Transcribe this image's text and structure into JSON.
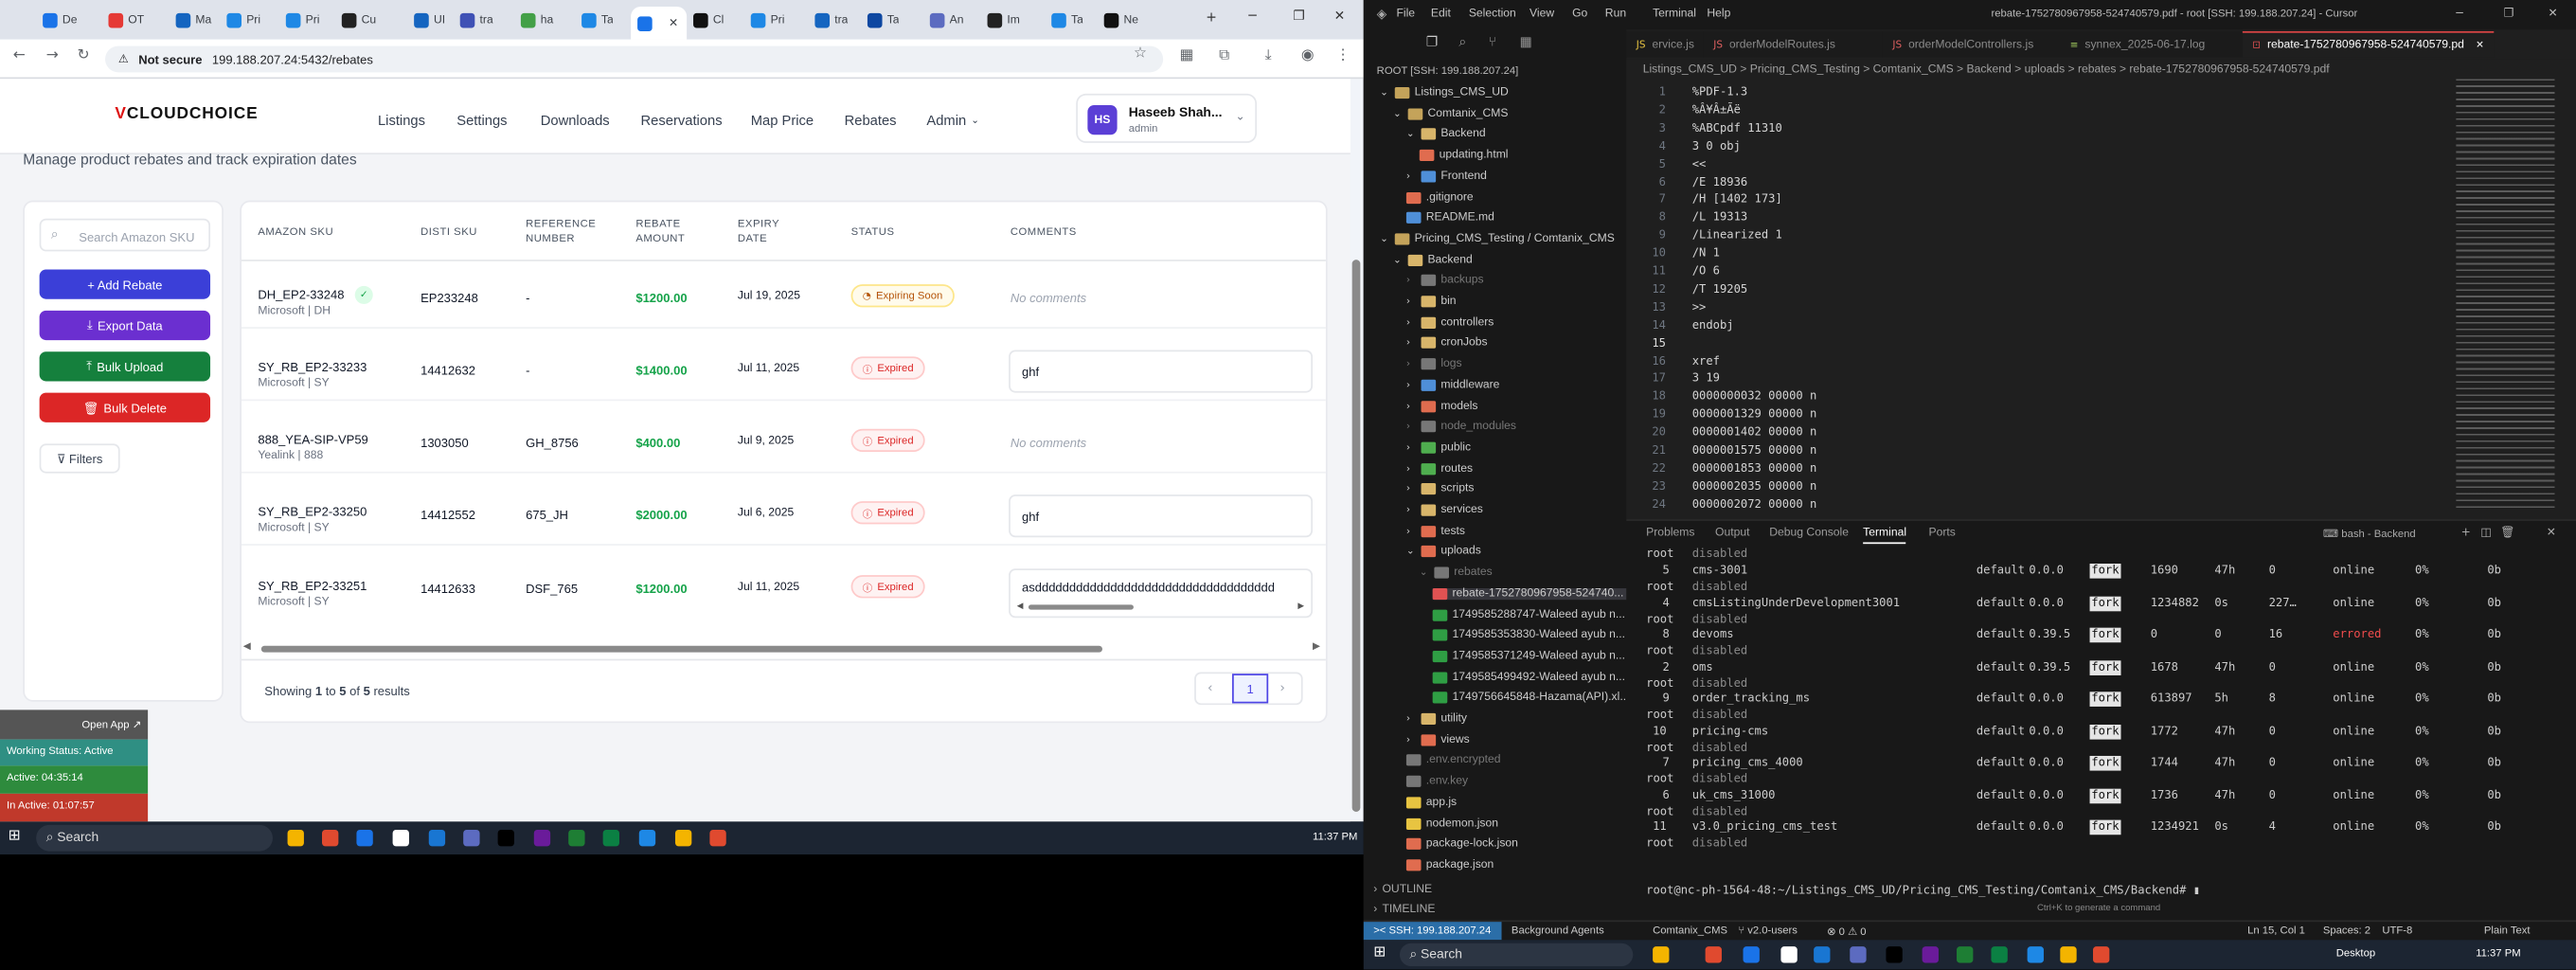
{
  "browser": {
    "tabs": [
      "De",
      "OT",
      "Ma",
      "Pri",
      "Pri",
      "Cu",
      "UI",
      "tra",
      "ha",
      "Ta",
      "",
      "Cl",
      "Pri",
      "tra",
      "Ta",
      "An",
      "Im",
      "Ta",
      "Ne"
    ],
    "security": "Not secure",
    "url": "199.188.207.24:5432/rebates"
  },
  "app": {
    "brand": "CLOUDCHOICE",
    "brand_v": "V",
    "nav": [
      "Listings",
      "Settings",
      "Downloads",
      "Reservations",
      "Map Price",
      "Rebates",
      "Admin"
    ],
    "user": {
      "initials": "HS",
      "name": "Haseeb Shah...",
      "role": "admin"
    },
    "subtitle": "Manage product rebates and track expiration dates",
    "search_placeholder": "Search Amazon SKU",
    "buttons": {
      "add": "+ Add Rebate",
      "export": "Export Data",
      "upload": "Bulk Upload",
      "delete": "Bulk Delete",
      "filters": "Filters"
    },
    "columns": [
      "AMAZON SKU",
      "DISTI SKU",
      "REFERENCE NUMBER",
      "REBATE AMOUNT",
      "EXPIRY DATE",
      "STATUS",
      "COMMENTS"
    ],
    "rows": [
      {
        "sku": "DH_EP2-33248",
        "vendor": "Microsoft | DH",
        "disti": "EP233248",
        "ref": "-",
        "amount": "$1200.00",
        "expiry": "Jul 19, 2025",
        "status": "Expiring Soon",
        "comment": "No comments"
      },
      {
        "sku": "SY_RB_EP2-33233",
        "vendor": "Microsoft | SY",
        "disti": "14412632",
        "ref": "-",
        "amount": "$1400.00",
        "expiry": "Jul 11, 2025",
        "status": "Expired",
        "comment": "ghf"
      },
      {
        "sku": "888_YEA-SIP-VP59",
        "vendor": "Yealink | 888",
        "disti": "1303050",
        "ref": "GH_8756",
        "amount": "$400.00",
        "expiry": "Jul 9, 2025",
        "status": "Expired",
        "comment": "No comments"
      },
      {
        "sku": "SY_RB_EP2-33250",
        "vendor": "Microsoft | SY",
        "disti": "14412552",
        "ref": "675_JH",
        "amount": "$2000.00",
        "expiry": "Jul 6, 2025",
        "status": "Expired",
        "comment": "ghf"
      },
      {
        "sku": "SY_RB_EP2-33251",
        "vendor": "Microsoft | SY",
        "disti": "14412633",
        "ref": "DSF_765",
        "amount": "$1200.00",
        "expiry": "Jul 11, 2025",
        "status": "Expired",
        "comment": "asddddddddddddddddddddddddddddddddddd"
      }
    ],
    "showing": {
      "pre": "Showing",
      "from": "1",
      "to_word": "to",
      "to": "5",
      "of_word": "of",
      "total": "5",
      "post": "results"
    },
    "page": "1"
  },
  "widget": {
    "open": "Open App",
    "working": "Working Status: Active",
    "active": "Active: 04:35:14",
    "inactive": "In Active: 01:07:57"
  },
  "taskbar": {
    "search": "Search",
    "time": "11:37 PM",
    "desktop": "Desktop"
  },
  "vscode": {
    "title": "rebate-1752780967958-524740579.pdf - root [SSH: 199.188.207.24] - Cursor",
    "menus": [
      "File",
      "Edit",
      "Selection",
      "View",
      "Go",
      "Run",
      "Terminal",
      "Help"
    ],
    "tabs": [
      "ervice.js",
      "orderModelRoutes.js",
      "orderModelControllers.js",
      "synnex_2025-06-17.log",
      "rebate-1752780967958-524740579.pdf"
    ],
    "breadcrumb": "Listings_CMS_UD > Pricing_CMS_Testing > Comtanix_CMS > Backend > uploads > rebates > rebate-1752780967958-524740579.pdf",
    "root_label": "ROOT [SSH: 199.188.207.24]",
    "tree": [
      "Listings_CMS_UD",
      "Comtanix_CMS",
      "Backend",
      "updating.html",
      "Frontend",
      ".gitignore",
      "README.md",
      "Pricing_CMS_Testing / Comtanix_CMS",
      "Backend",
      "backups",
      "bin",
      "controllers",
      "cronJobs",
      "logs",
      "middleware",
      "models",
      "node_modules",
      "public",
      "routes",
      "scripts",
      "services",
      "tests",
      "uploads",
      "rebates",
      "rebate-1752780967958-524740...",
      "1749585288747-Waleed ayub n...",
      "1749585353830-Waleed ayub n...",
      "1749585371249-Waleed ayub n...",
      "1749585499492-Waleed ayub n...",
      "1749756645848-Hazama(API).xl...",
      "utility",
      "views",
      ".env.encrypted",
      ".env.key",
      "app.js",
      "nodemon.json",
      "package-lock.json",
      "package.json"
    ],
    "outline": "OUTLINE",
    "timeline": "TIMELINE",
    "code": [
      "%PDF-1.3",
      "%Â¥Â±Ãë",
      "%ABCpdf 11310",
      "3 0 obj",
      "<<",
      "/E 18936",
      "/H [1402 173]",
      "/L 19313",
      "/Linearized 1",
      "/N 1",
      "/O 6",
      "/T 19205",
      ">>",
      "endobj",
      "",
      "xref",
      "3 19",
      "0000000032 00000 n",
      "0000001329 00000 n",
      "0000001402 00000 n",
      "0000001575 00000 n",
      "0000001853 00000 n",
      "0000002035 00000 n",
      "0000002072 00000 n"
    ],
    "panel_tabs": [
      "Problems",
      "Output",
      "Debug Console",
      "Terminal",
      "Ports"
    ],
    "terminal_label": "bash - Backend",
    "procs": [
      {
        "id": "5",
        "name": "cms-3001",
        "ns": "default",
        "ver": "0.0.0",
        "mode": "fork",
        "pid": "1690",
        "up": "47h",
        "rst": "0",
        "status": "online",
        "cpu": "0%",
        "mem": "0b"
      },
      {
        "id": "4",
        "name": "cmsListingUnderDevelopment3001",
        "ns": "default",
        "ver": "0.0.0",
        "mode": "fork",
        "pid": "1234882",
        "up": "0s",
        "rst": "227…",
        "status": "online",
        "cpu": "0%",
        "mem": "0b"
      },
      {
        "id": "8",
        "name": "devoms",
        "ns": "default",
        "ver": "0.39.5",
        "mode": "fork",
        "pid": "0",
        "up": "0",
        "rst": "16",
        "status": "errored",
        "cpu": "0%",
        "mem": "0b"
      },
      {
        "id": "2",
        "name": "oms",
        "ns": "default",
        "ver": "0.39.5",
        "mode": "fork",
        "pid": "1678",
        "up": "47h",
        "rst": "0",
        "status": "online",
        "cpu": "0%",
        "mem": "0b"
      },
      {
        "id": "9",
        "name": "order_tracking_ms",
        "ns": "default",
        "ver": "0.0.0",
        "mode": "fork",
        "pid": "613897",
        "up": "5h",
        "rst": "8",
        "status": "online",
        "cpu": "0%",
        "mem": "0b"
      },
      {
        "id": "10",
        "name": "pricing-cms",
        "ns": "default",
        "ver": "0.0.0",
        "mode": "fork",
        "pid": "1772",
        "up": "47h",
        "rst": "0",
        "status": "online",
        "cpu": "0%",
        "mem": "0b"
      },
      {
        "id": "7",
        "name": "pricing_cms_4000",
        "ns": "default",
        "ver": "0.0.0",
        "mode": "fork",
        "pid": "1744",
        "up": "47h",
        "rst": "0",
        "status": "online",
        "cpu": "0%",
        "mem": "0b"
      },
      {
        "id": "6",
        "name": "uk_cms_31000",
        "ns": "default",
        "ver": "0.0.0",
        "mode": "fork",
        "pid": "1736",
        "up": "47h",
        "rst": "0",
        "status": "online",
        "cpu": "0%",
        "mem": "0b"
      },
      {
        "id": "11",
        "name": "v3.0_pricing_cms_test",
        "ns": "default",
        "ver": "0.0.0",
        "mode": "fork",
        "pid": "1234921",
        "up": "0s",
        "rst": "4",
        "status": "online",
        "cpu": "0%",
        "mem": "0b"
      }
    ],
    "root": "root",
    "disabled": "disabled",
    "prompt": "root@nc-ph-1564-48:~/Listings_CMS_UD/Pricing_CMS_Testing/Comtanix_CMS/Backend#",
    "hint": "Ctrl+K to generate a command",
    "status": {
      "ssh": "SSH: 199.188.207.24",
      "agents": "Background Agents",
      "repo": "Comtanix_CMS",
      "branch": "v2.0-users",
      "errors": "0",
      "warnings": "0",
      "pos": "Ln 15, Col 1",
      "spaces": "Spaces: 2",
      "enc": "UTF-8",
      "lang": "Plain Text"
    }
  }
}
